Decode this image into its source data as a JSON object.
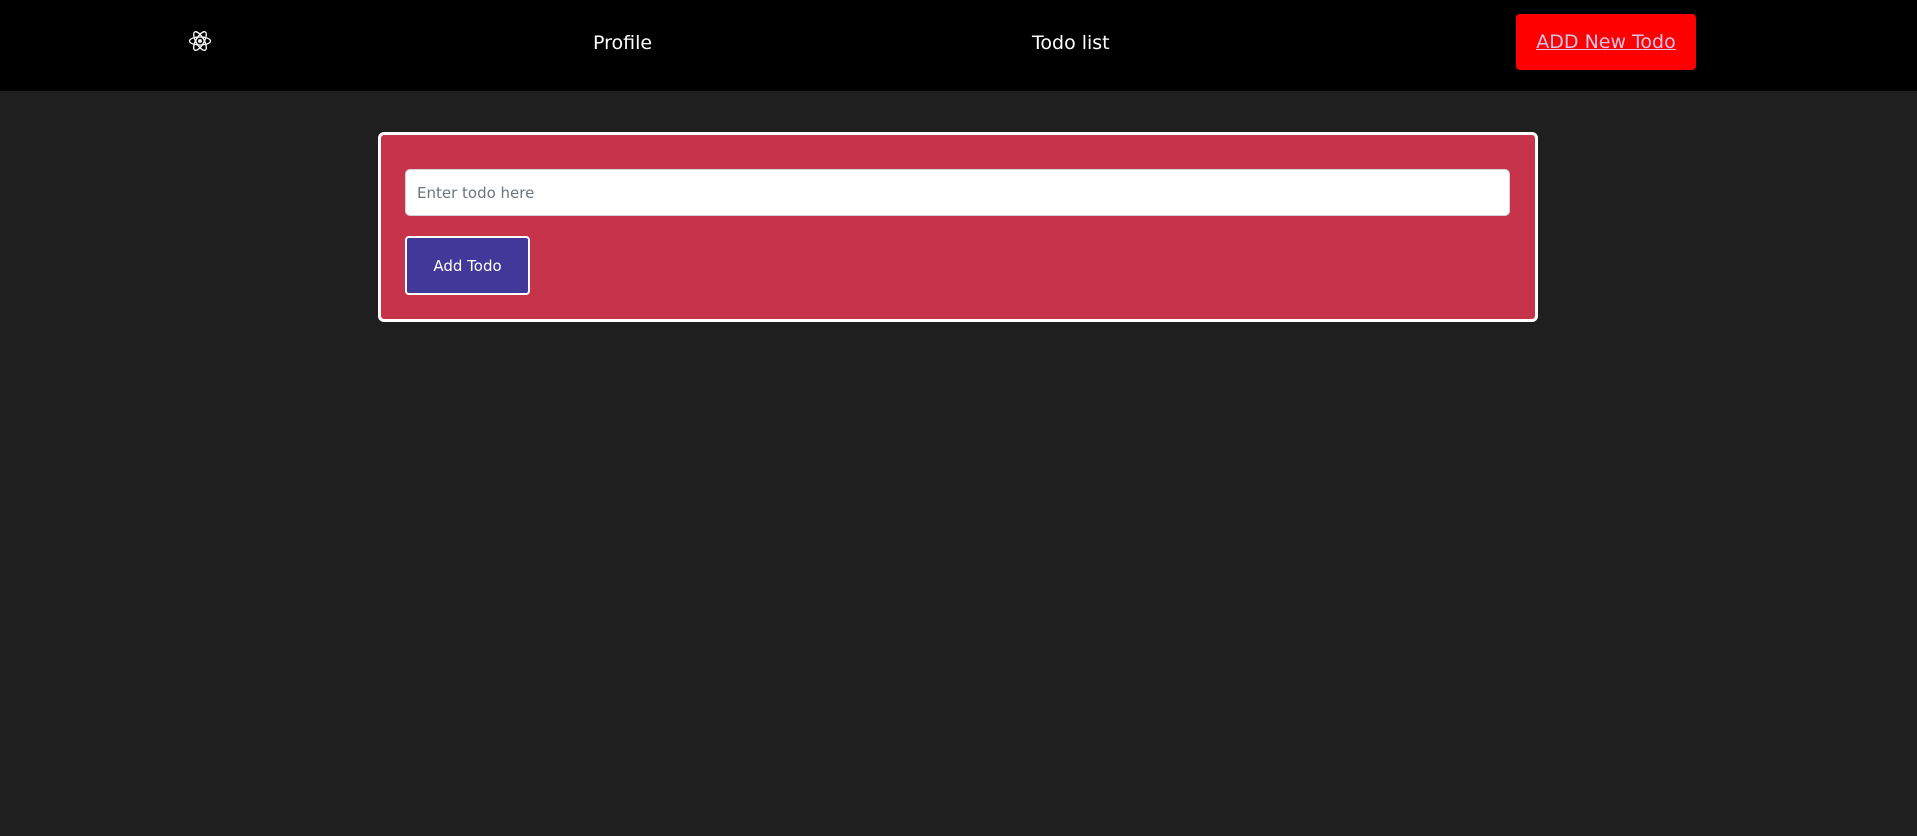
{
  "colors": {
    "page_background": "#201f20",
    "navbar_background": "#000000",
    "add_new_button_background": "#ff0000",
    "add_new_link_text": "#dcc6e8",
    "form_card_background": "#c8334c",
    "add_todo_button_background": "#42389a"
  },
  "navbar": {
    "logo_icon": "react-atom-icon",
    "profile_label": "Profile",
    "todo_list_label": "Todo list",
    "add_new_label": "ADD New Todo"
  },
  "todo_form": {
    "input_value": "",
    "input_placeholder": "Enter todo here",
    "submit_label": "Add Todo"
  }
}
